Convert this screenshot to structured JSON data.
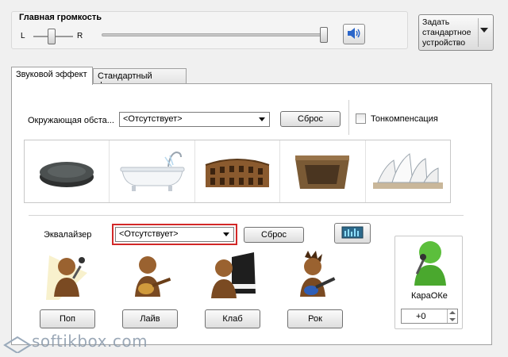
{
  "master_volume": {
    "title": "Главная громкость",
    "left_label": "L",
    "right_label": "R",
    "volume_level_percent": 98,
    "balance_percent": 50
  },
  "default_device_button": {
    "label": "Задать стандартное устройство"
  },
  "tabs": [
    {
      "label": "Звуковой эффект",
      "active": true
    },
    {
      "label": "Стандартный формат",
      "active": false
    }
  ],
  "environment": {
    "label": "Окружающая обста...",
    "selected": "<Отсутствует>",
    "reset_label": "Сброс",
    "loudness_label": "Тонкомпенсация",
    "loudness_checked": false,
    "presets": [
      "stone-disc",
      "bathtub",
      "colosseum",
      "stone-room",
      "opera-house"
    ]
  },
  "equalizer": {
    "label": "Эквалайзер",
    "selected": "<Отсутствует>",
    "reset_label": "Сброс",
    "presets": [
      {
        "label": "Поп",
        "icon": "pop-singer-icon"
      },
      {
        "label": "Лайв",
        "icon": "live-guitar-icon"
      },
      {
        "label": "Клаб",
        "icon": "club-piano-icon"
      },
      {
        "label": "Рок",
        "icon": "rock-guitar-icon"
      }
    ]
  },
  "karaoke": {
    "label": "КараОКе",
    "value": "+0"
  },
  "watermark": "softikbox.com",
  "colors": {
    "window_bg": "#f0f0f0",
    "highlight_red": "#d22828",
    "karaoke_green": "#5cbf3c"
  }
}
